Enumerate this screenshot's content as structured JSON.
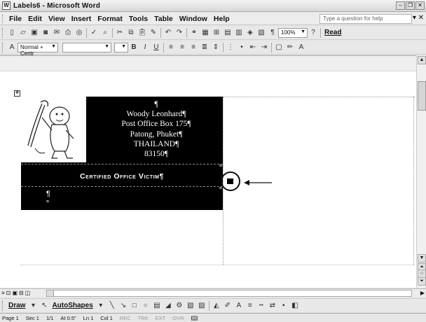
{
  "window": {
    "title": "Labels6 - Microsoft Word"
  },
  "menubar": {
    "items": [
      "File",
      "Edit",
      "View",
      "Insert",
      "Format",
      "Tools",
      "Table",
      "Window",
      "Help"
    ],
    "help_placeholder": "Type a question for help"
  },
  "standard_toolbar": {
    "zoom": "100%",
    "read_label": "Read"
  },
  "formatting_toolbar": {
    "style_value": "Normal + Centr"
  },
  "label": {
    "address_lines": [
      "Woody Leonhard¶",
      "Post Office Box 175¶",
      "Patong, Phuket¶",
      "THAILAND¶",
      "83150¶"
    ],
    "pilcrow_top": "¶",
    "certified_text": "Certified Office Victim¶",
    "empty_para": "¶",
    "end_mark": "¤",
    "cell_mark": "¶"
  },
  "drawing_toolbar": {
    "draw_label": "Draw",
    "autoshapes_label": "AutoShapes"
  },
  "statusbar": {
    "page": "Page 1",
    "sec": "Sec 1",
    "page_of": "1/1",
    "at": "At 0.5\"",
    "ln": "Ln 1",
    "col": "Col 1",
    "rec": "REC",
    "trk": "TRK",
    "ext": "EXT",
    "ovr": "OVR"
  }
}
